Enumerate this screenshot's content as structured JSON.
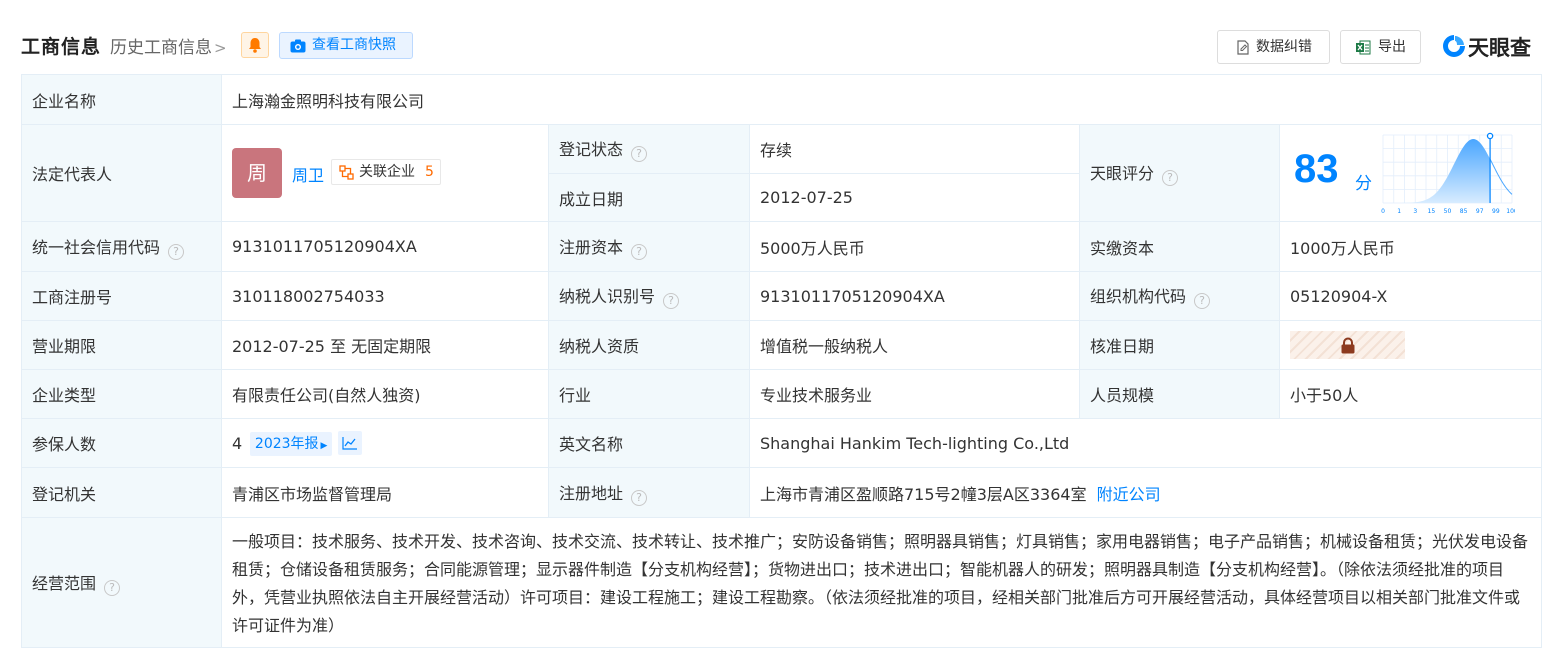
{
  "header": {
    "title": "工商信息",
    "history_link": "历史工商信息",
    "snapshot_button": "查看工商快照",
    "correct_button": "数据纠错",
    "export_button": "导出",
    "brand": "天眼查",
    "brand_color": "#0084ff"
  },
  "company": {
    "name_label": "企业名称",
    "name_value": "上海瀚金照明科技有限公司"
  },
  "legal_rep": {
    "label": "法定代表人",
    "avatar_char": "周",
    "name": "周卫",
    "related_label": "关联企业",
    "related_count": "5"
  },
  "reg_status": {
    "label": "登记状态",
    "value": "存续",
    "value_color": "#00a854"
  },
  "established": {
    "label": "成立日期",
    "value": "2012-07-25"
  },
  "score": {
    "label": "天眼评分",
    "value": "83",
    "unit": "分",
    "axis_ticks": [
      "0",
      "1",
      "3",
      "15",
      "50",
      "85",
      "97",
      "99",
      "100"
    ]
  },
  "rows": {
    "credit_code": {
      "label": "统一社会信用代码",
      "value": "913101170512090 4XA"
    },
    "reg_capital": {
      "label": "注册资本",
      "value": "5000万人民币"
    },
    "paid_capital": {
      "label": "实缴资本",
      "value": "1000万人民币"
    },
    "reg_number": {
      "label": "工商注册号",
      "value": "310118002754033"
    },
    "taxpayer_id": {
      "label": "纳税人识别号",
      "value": "913101170512090 4XA"
    },
    "org_code": {
      "label": "组织机构代码",
      "value": "05120904-X"
    },
    "term": {
      "label": "营业期限",
      "value": "2012-07-25 至 无固定期限"
    },
    "tax_qual": {
      "label": "纳税人资质",
      "value": "增值税一般纳税人"
    },
    "approval_date": {
      "label": "核准日期"
    },
    "ent_type": {
      "label": "企业类型",
      "value": "有限责任公司(自然人独资)"
    },
    "industry": {
      "label": "行业",
      "value": "专业技术服务业"
    },
    "staff_size": {
      "label": "人员规模",
      "value": "小于50人"
    },
    "insured": {
      "label": "参保人数",
      "value": "4",
      "report_button": "2023年报"
    },
    "english_name": {
      "label": "英文名称",
      "value": "Shanghai Hankim Tech-lighting Co.,Ltd"
    },
    "reg_authority": {
      "label": "登记机关",
      "value": "青浦区市场监督管理局"
    },
    "reg_address": {
      "label": "注册地址",
      "value": "上海市青浦区盈顺路715号2幢3层A区3364室",
      "nearby_link": "附近公司"
    },
    "scope": {
      "label": "经营范围",
      "value": "一般项目：技术服务、技术开发、技术咨询、技术交流、技术转让、技术推广；安防设备销售；照明器具销售；灯具销售；家用电器销售；电子产品销售；机械设备租赁；光伏发电设备租赁；仓储设备租赁服务；合同能源管理；显示器件制造【分支机构经营】；货物进出口；技术进出口；智能机器人的研发；照明器具制造【分支机构经营】。（除依法须经批准的项目外，凭营业执照依法自主开展经营活动）许可项目：建设工程施工；建设工程勘察。（依法须经批准的项目，经相关部门批准后方可开展经营活动，具体经营项目以相关部门批准文件或许可证件为准）"
    }
  }
}
